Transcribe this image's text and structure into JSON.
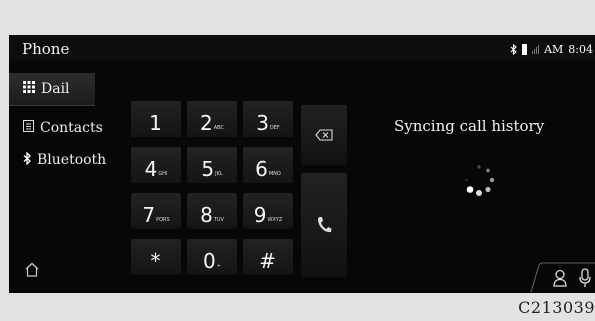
{
  "header": {
    "title": "Phone"
  },
  "status": {
    "ampm": "AM",
    "time": "8:04",
    "icons": [
      "bluetooth-icon",
      "battery-icon",
      "signal-icon"
    ]
  },
  "sidebar": {
    "items": [
      {
        "label": "Dail",
        "icon": "dialpad-icon",
        "active": true
      },
      {
        "label": "Contacts",
        "icon": "contacts-book-icon",
        "active": false
      },
      {
        "label": "Bluetooth",
        "icon": "bluetooth-icon",
        "active": false
      }
    ],
    "home_icon": "home-icon"
  },
  "keypad": {
    "keys": [
      {
        "digit": "1",
        "letters": ""
      },
      {
        "digit": "2",
        "letters": "ABC"
      },
      {
        "digit": "3",
        "letters": "DEF"
      },
      {
        "digit": "4",
        "letters": "GHI"
      },
      {
        "digit": "5",
        "letters": "JKL"
      },
      {
        "digit": "6",
        "letters": "MNO"
      },
      {
        "digit": "7",
        "letters": "PQRS"
      },
      {
        "digit": "8",
        "letters": "TUV"
      },
      {
        "digit": "9",
        "letters": "WXYZ"
      },
      {
        "digit": "*",
        "letters": ""
      },
      {
        "digit": "0",
        "letters": "+"
      },
      {
        "digit": "#",
        "letters": ""
      }
    ],
    "backspace_icon": "backspace-icon",
    "call_icon": "phone-handset-icon"
  },
  "main": {
    "sync_text": "Syncing call history"
  },
  "tray": {
    "icons": [
      "person-icon",
      "microphone-icon"
    ]
  },
  "figure_code": "C213039"
}
